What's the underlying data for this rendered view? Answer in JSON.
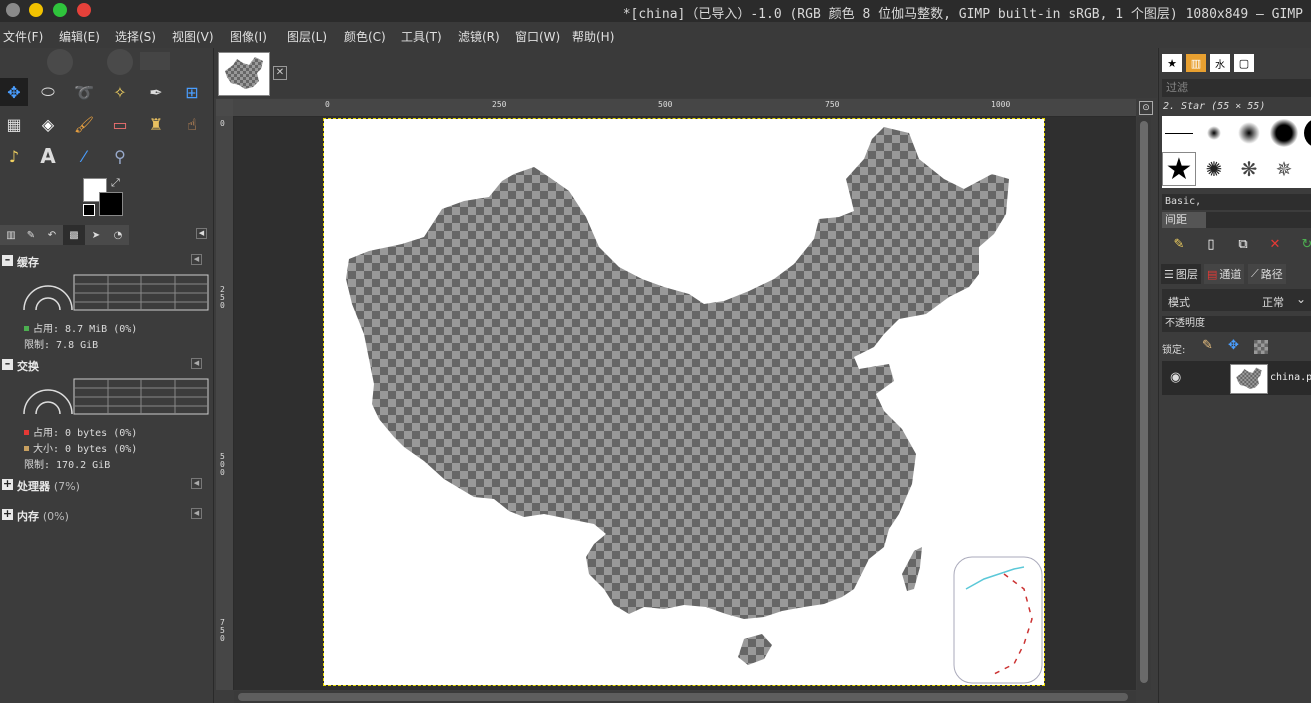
{
  "window": {
    "title": "*[china]（已导入）-1.0 (RGB 颜色 8 位伽马整数, GIMP built-in sRGB, 1 个图层) 1080x849 – GIMP"
  },
  "menu": [
    "文件(F)",
    "编辑(E)",
    "选择(S)",
    "视图(V)",
    "图像(I)",
    "图层(L)",
    "颜色(C)",
    "工具(T)",
    "滤镜(R)",
    "窗口(W)",
    "帮助(H)"
  ],
  "colors": {
    "foreground": "#ffffff",
    "background": "#000000",
    "accent": "#4a9eff",
    "titlebar": "#2b2b2b",
    "panel": "#3c3c3c",
    "selection_outline": "#e6d800"
  },
  "toolbox": {
    "tools": [
      "move-tool",
      "ellipse-select-tool",
      "free-select-tool",
      "fuzzy-select-tool",
      "paths-tool",
      "align-tool",
      "warp-transform-tool",
      "bucket-fill-tool",
      "paintbrush-tool",
      "eraser-tool",
      "clone-tool",
      "smudge-tool",
      "dodge-tool",
      "text-tool",
      "color-picker-tool",
      "zoom-tool"
    ],
    "active_tool": "move-tool"
  },
  "dashboard": {
    "cache": {
      "label": "缓存",
      "used": "占用: 8.7 MiB (0%)",
      "limit": "限制: 7.8 GiB"
    },
    "swap": {
      "label": "交换",
      "used": "占用: 0 bytes (0%)",
      "size": "大小: 0 bytes (0%)",
      "limit": "限制: 170.2 GiB"
    },
    "cpu": {
      "label": "处理器",
      "value": "(7%)"
    },
    "memory": {
      "label": "内存",
      "value": "(0%)"
    }
  },
  "rulers": {
    "h_ticks": [
      "0",
      "250",
      "500",
      "750",
      "1000"
    ],
    "v_ticks": [
      "0",
      "250",
      "500",
      "750"
    ]
  },
  "image_tab": {
    "close": "✕"
  },
  "brushes": {
    "filter_placeholder": "过滤",
    "selected": "2. Star (55 × 55)",
    "tag": "Basic,",
    "spacing_label": "间距"
  },
  "layers": {
    "tabs": [
      "图层",
      "通道",
      "路径"
    ],
    "mode_label": "模式",
    "mode_value": "正常",
    "opacity_label": "不透明度",
    "lock_label": "锁定:",
    "layer_name": "china.png"
  }
}
